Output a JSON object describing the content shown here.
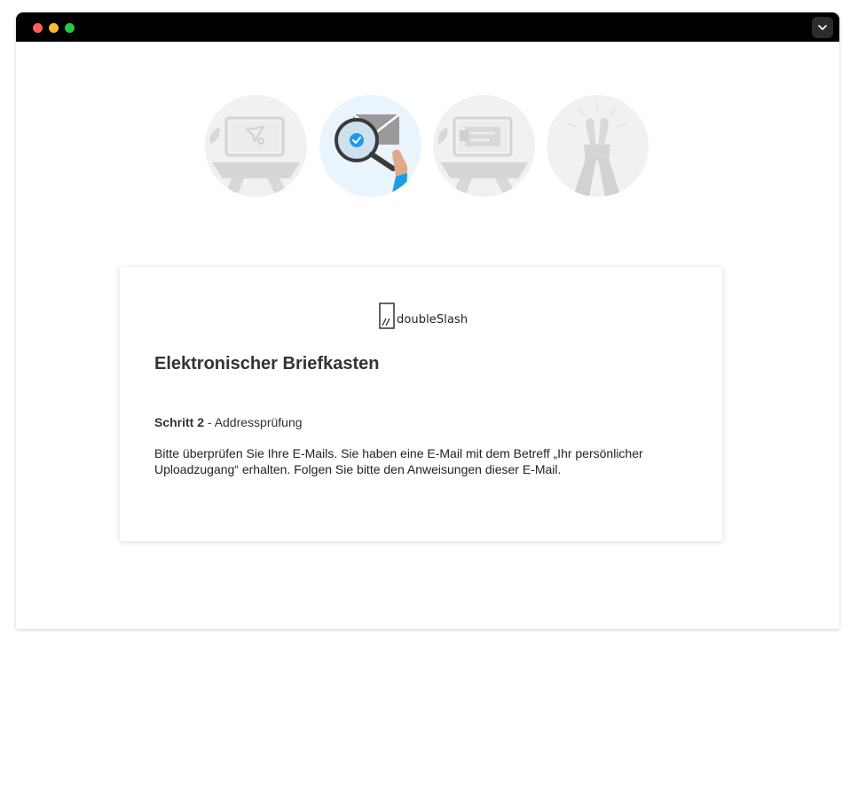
{
  "window": {
    "controls": [
      "close",
      "minimize",
      "maximize"
    ],
    "menu_icon": "chevron-down-icon"
  },
  "steps": [
    {
      "icon": "laptop-send-icon",
      "state": "inactive"
    },
    {
      "icon": "mail-search-icon",
      "state": "active"
    },
    {
      "icon": "laptop-form-icon",
      "state": "inactive"
    },
    {
      "icon": "hands-raised-icon",
      "state": "inactive"
    }
  ],
  "card": {
    "logo_text": "doubleSlash",
    "title": "Elektronischer Briefkasten",
    "step_label": "Schritt 2",
    "step_separator": " - ",
    "step_name": "Addressprüfung",
    "instruction": "Bitte überprüfen Sie Ihre E-Mails. Sie haben eine E-Mail mit dem Betreff „Ihr persönlicher Uploadzugang“ erhalten. Folgen Sie bitte den Anweisungen dieser E-Mail."
  },
  "colors": {
    "titlebar": "#000000",
    "active_step_bg": "#eaf4fd",
    "inactive_step_bg": "#f1f1f1",
    "accent_blue": "#1e9be8",
    "text_dark": "#333333"
  }
}
